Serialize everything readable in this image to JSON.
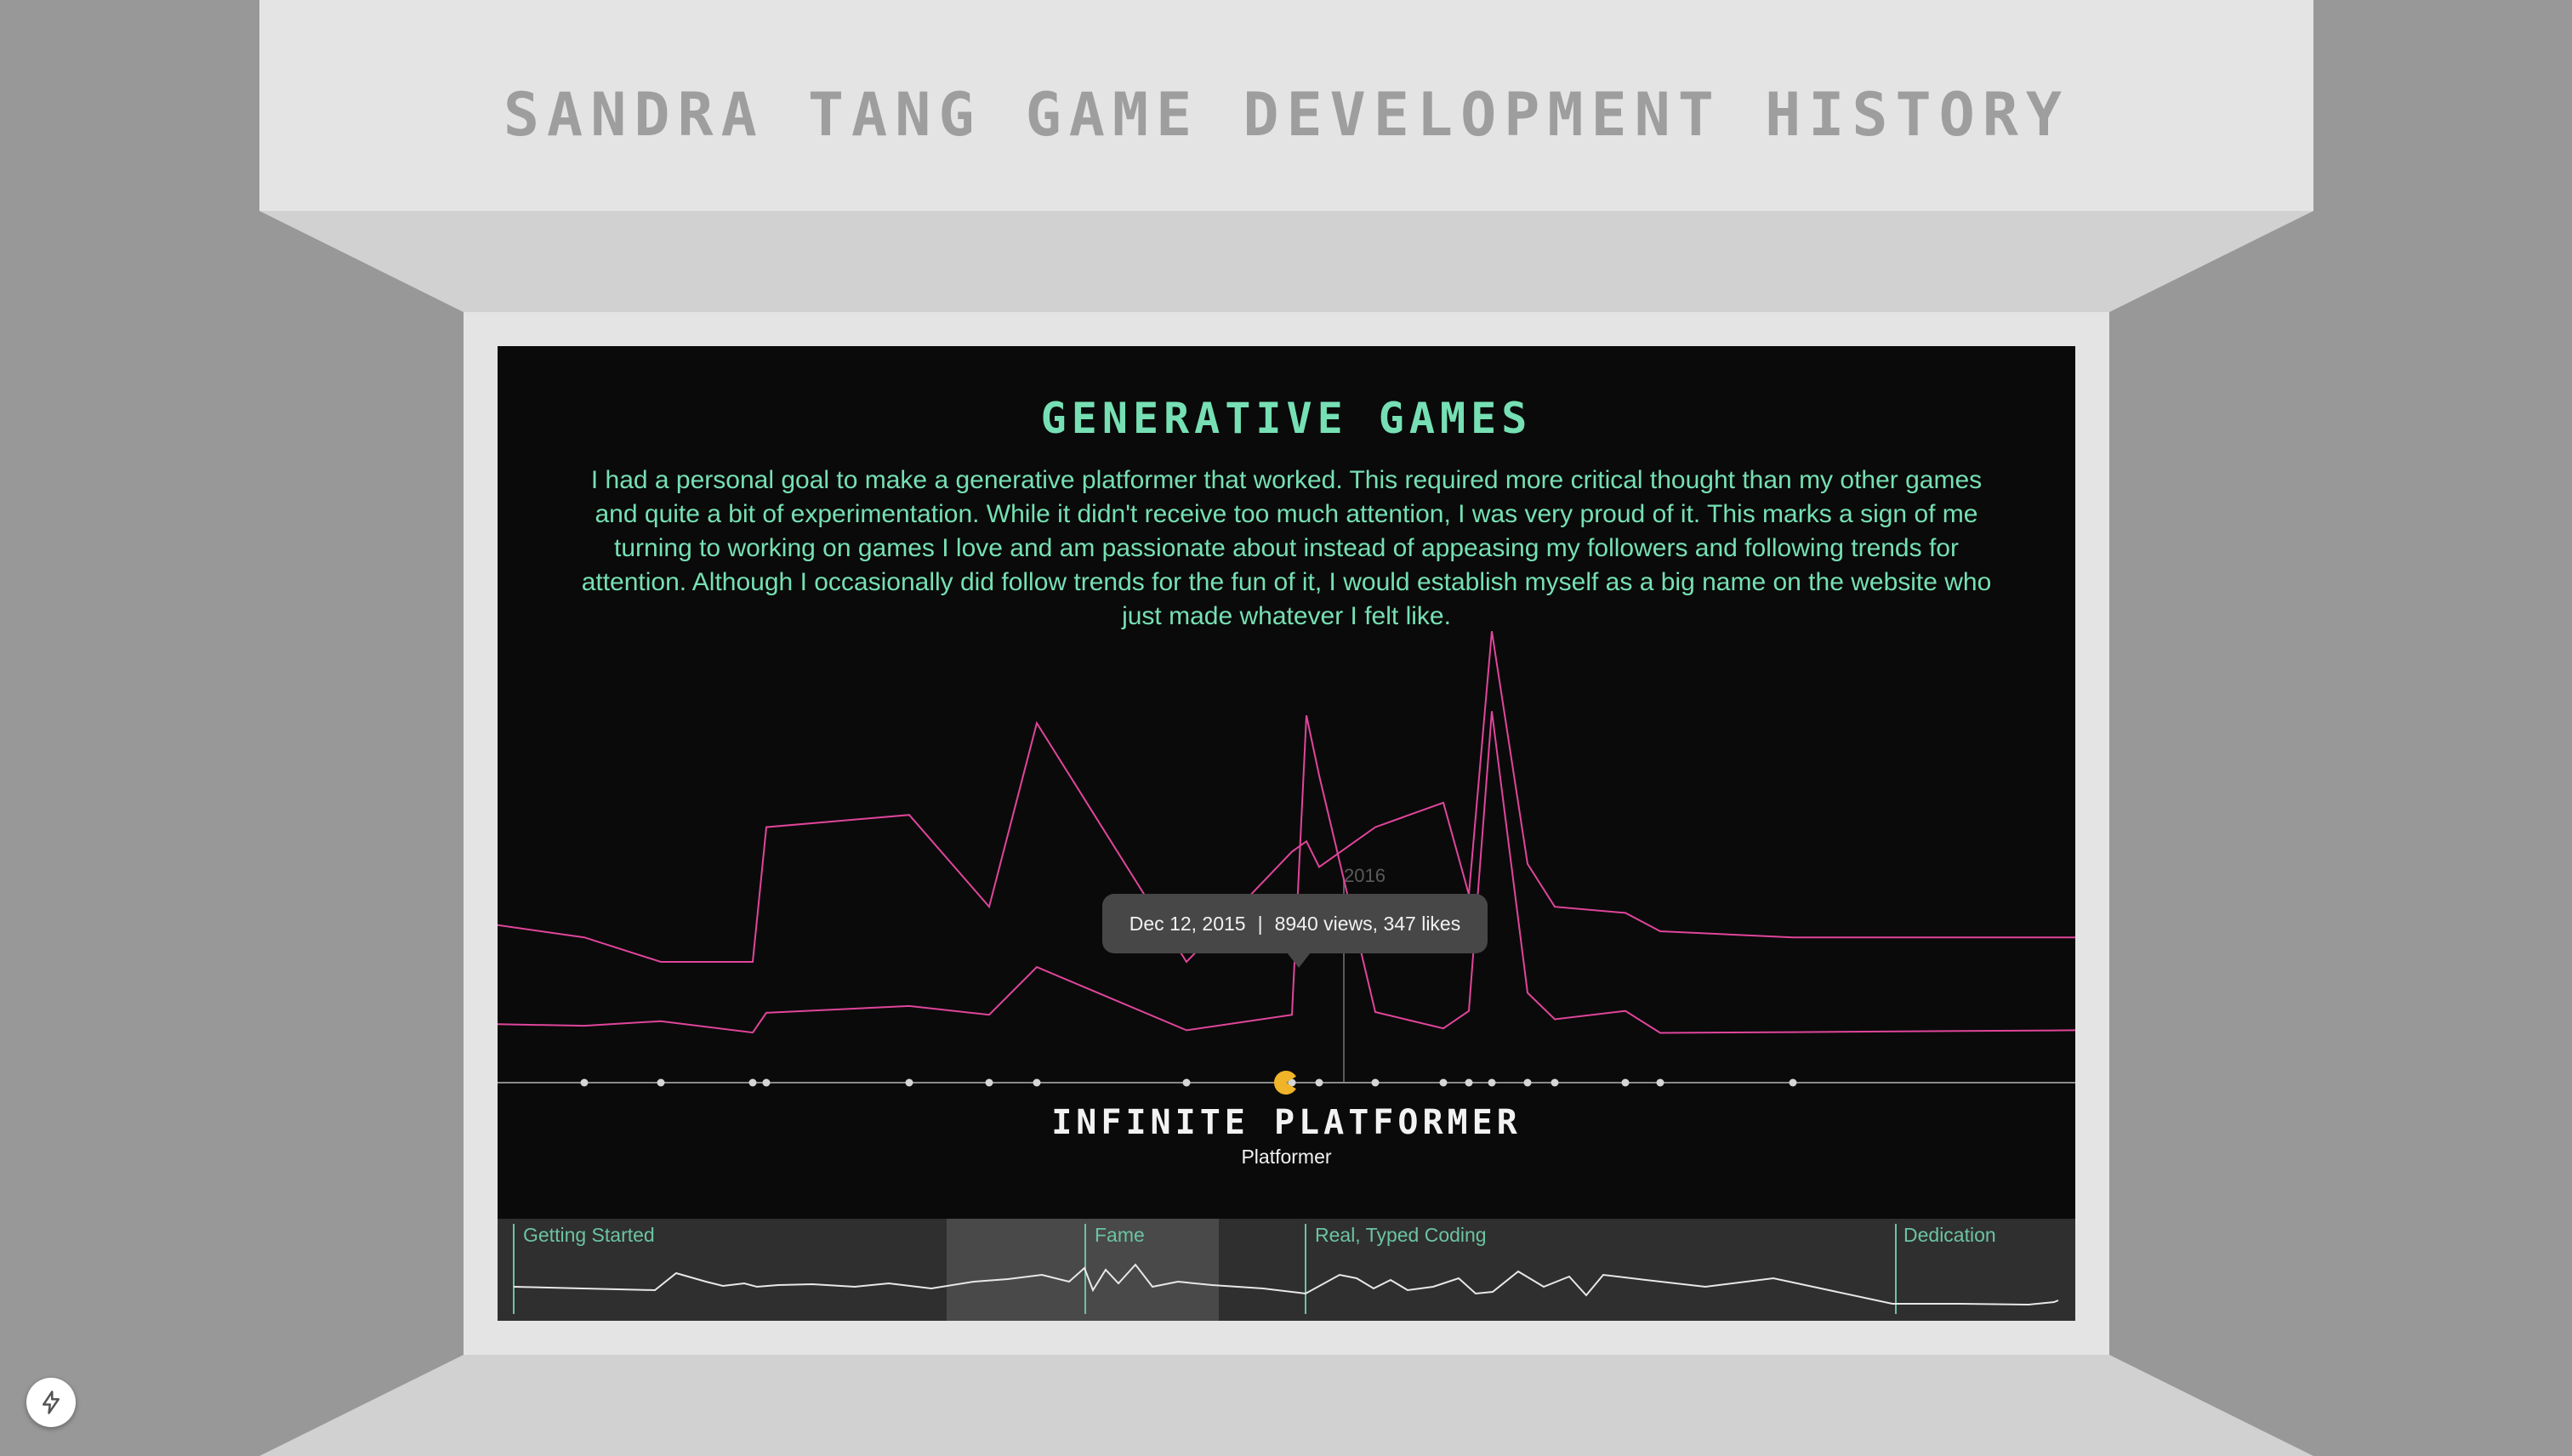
{
  "page": {
    "title": "SANDRA TANG GAME DEVELOPMENT HISTORY"
  },
  "era": {
    "title": "GENERATIVE GAMES",
    "description": "I had a personal goal to make a generative platformer that worked. This required more critical thought than my other games and quite a bit of experimentation. While it didn't receive too much attention, I was very proud of it. This marks a sign of me turning to working on games I love and am passionate about instead of appeasing my followers and following trends for attention. Although I occasionally did follow trends for the fun of it, I would establish myself as a big name on the website who just made whatever I felt like."
  },
  "tooltip": {
    "date": "Dec 12, 2015",
    "separator": "|",
    "stats": "8940 views, 347 likes"
  },
  "selected_game": {
    "title": "INFINITE PLATFORMER",
    "genre": "Platformer",
    "marker_icon": "pacman-icon"
  },
  "year_marker": {
    "label": "2016"
  },
  "overview": {
    "phases": [
      "Getting Started",
      "Fame",
      "Real, Typed Coding",
      "Dedication"
    ]
  },
  "colors": {
    "background": "#989898",
    "screen": "#0a0a0a",
    "accent_text": "#76e0b4",
    "series_line": "#e0459b",
    "marker": "#f0b429",
    "overview_panel": "#2f2f2f",
    "phase_label": "#6cc3a2"
  },
  "chart_data": {
    "type": "line",
    "title": "",
    "xlabel": "",
    "ylabel": "",
    "x_tick_labels": [
      "2016"
    ],
    "x": [
      1,
      2,
      3,
      4,
      5,
      6,
      7,
      8,
      9,
      10,
      11,
      12,
      13,
      14,
      15,
      16,
      17,
      18,
      19,
      20,
      21,
      22
    ],
    "series": [
      {
        "values": [
          780,
          740,
          860,
          560,
          1080,
          1260,
          1030,
          2290,
          620,
          1030,
          8940,
          7350,
          1100,
          670,
          1130,
          9050,
          1610,
          910,
          1130,
          550,
          570,
          620
        ]
      },
      {
        "values": [
          210,
          190,
          150,
          150,
          370,
          390,
          240,
          540,
          150,
          330,
          347,
          305,
          370,
          410,
          260,
          690,
          310,
          240,
          230,
          200,
          190,
          190
        ]
      }
    ],
    "selected_point_index": 10,
    "grid": false,
    "legend": "none"
  },
  "footer": {
    "dev_icon": "lightning-icon"
  }
}
